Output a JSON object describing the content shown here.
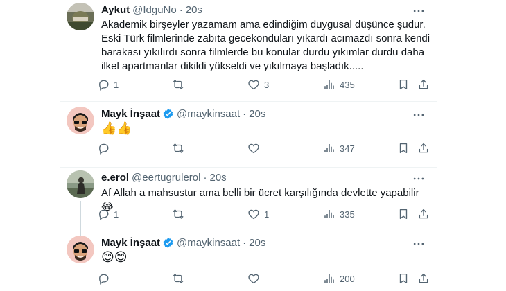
{
  "tweets": [
    {
      "name": "Aykut",
      "handle": "@IdguNo",
      "time": "20s",
      "verified": false,
      "text": "Akademik birşeyler yazamam ama edindiğim duygusal düşünce şudur. Eski Türk filmlerinde zabıta gecekonduları yıkardı acımazdı sonra kendi barakası yıkılırdı sonra filmlerde bu konular durdu yıkımlar durdu daha ilkel apartmanlar dikildi yükseldi ve yıkılmaya başladık.....",
      "replies": "1",
      "retweets": "",
      "likes": "3",
      "views": "435"
    },
    {
      "name": "Mayk İnşaat",
      "handle": "@maykinsaat",
      "time": "20s",
      "verified": true,
      "text": "👍👍",
      "replies": "",
      "retweets": "",
      "likes": "",
      "views": "347"
    },
    {
      "name": "e.erol",
      "handle": "@eertugrulerol",
      "time": "20s",
      "verified": false,
      "text": "Af Allah a mahsustur ama belli bir ücret karşılığında devlette yapabilir 😂",
      "replies": "1",
      "retweets": "",
      "likes": "1",
      "views": "335"
    },
    {
      "name": "Mayk İnşaat",
      "handle": "@maykinsaat",
      "time": "20s",
      "verified": true,
      "text": "😊😊",
      "replies": "",
      "retweets": "",
      "likes": "",
      "views": "200"
    }
  ],
  "separator": "·",
  "colors": {
    "verified": "#1d9bf0",
    "muted": "#536471",
    "divider": "#eff3f4",
    "thread": "#cfd9de"
  },
  "icons": [
    "reply-icon",
    "retweet-icon",
    "like-icon",
    "views-icon",
    "bookmark-icon",
    "share-icon",
    "more-icon",
    "verified-badge-icon"
  ]
}
